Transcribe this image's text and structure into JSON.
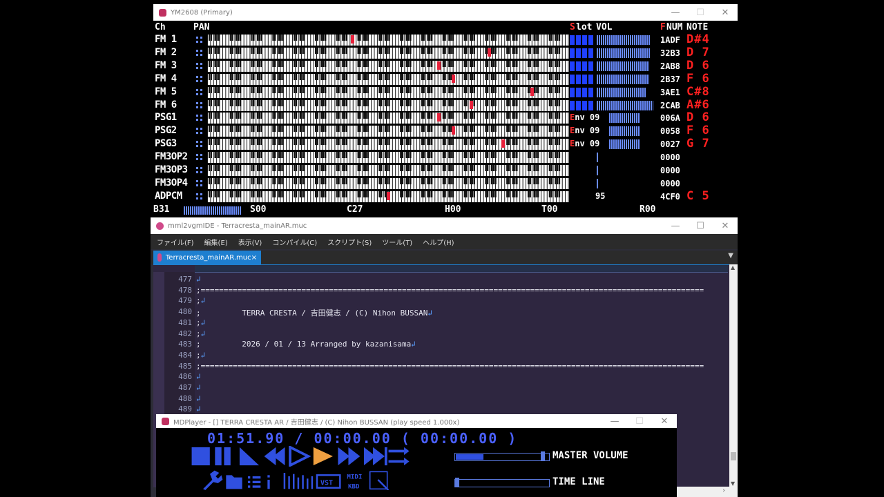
{
  "ym_window": {
    "title": "YM2608 (Primary)",
    "headers": {
      "ch": "Ch",
      "pan": "PAN",
      "slot_s": "S",
      "slot_rest": "lot",
      "vol": "VOL",
      "fnum_f": "F",
      "fnum_rest": "NUM",
      "note": "NOTE"
    },
    "channels": [
      {
        "label": "FM 1",
        "fnum": "1ADF",
        "note": "D#4"
      },
      {
        "label": "FM 2",
        "fnum": "32B3",
        "note": "D 7"
      },
      {
        "label": "FM 3",
        "fnum": "2AB8",
        "note": "D 6"
      },
      {
        "label": "FM 4",
        "fnum": "2B37",
        "note": "F 6"
      },
      {
        "label": "FM 5",
        "fnum": "3AE1",
        "note": "C#8"
      },
      {
        "label": "FM 6",
        "fnum": "2CAB",
        "note": "A#6"
      },
      {
        "label": "PSG1",
        "fnum": "006A",
        "note": "D 6",
        "env": "Env",
        "vol": "09"
      },
      {
        "label": "PSG2",
        "fnum": "0058",
        "note": "F 6",
        "env": "Env",
        "vol": "09"
      },
      {
        "label": "PSG3",
        "fnum": "0027",
        "note": "G 7",
        "env": "Env",
        "vol": "09"
      },
      {
        "label": "FM3OP2",
        "fnum": "0000",
        "note": ""
      },
      {
        "label": "FM3OP3",
        "fnum": "0000",
        "note": ""
      },
      {
        "label": "FM3OP4",
        "fnum": "0000",
        "note": ""
      },
      {
        "label": "ADPCM",
        "fnum": "4CF0",
        "note": "C 5",
        "extra": "95"
      }
    ],
    "bottom": {
      "b": "B31",
      "s": "S00",
      "c": "C27",
      "h": "H00",
      "t": "T00",
      "r": "R00"
    }
  },
  "ide_window": {
    "title": "mml2vgmIDE - Terracresta_mainAR.muc",
    "menu": [
      "ファイル(F)",
      "編集(E)",
      "表示(V)",
      "コンパイル(C)",
      "スクリプト(S)",
      "ツール(T)",
      "ヘルプ(H)"
    ],
    "tab_label": "Terracresta_mainAR.muc",
    "tab_close": "×",
    "lines": [
      {
        "num": "477",
        "text": ""
      },
      {
        "num": "478",
        "text": ";=============================================================================================================="
      },
      {
        "num": "479",
        "text": ";"
      },
      {
        "num": "480",
        "text": ";         TERRA CRESTA / 吉田健志 / (C) Nihon BUSSAN"
      },
      {
        "num": "481",
        "text": ";"
      },
      {
        "num": "482",
        "text": ";"
      },
      {
        "num": "483",
        "text": ";         2026 / 01 / 13 Arranged by kazanisama"
      },
      {
        "num": "484",
        "text": ";"
      },
      {
        "num": "485",
        "text": ";=============================================================================================================="
      },
      {
        "num": "486",
        "text": ""
      },
      {
        "num": "487",
        "text": ""
      },
      {
        "num": "488",
        "text": ""
      },
      {
        "num": "489",
        "text": ""
      }
    ],
    "return_mark": "↲"
  },
  "mdp_window": {
    "title": "MDPlayer - [] TERRA CRESTA AR / 吉田健志 / (C) Nihon BUSSAN (play speed 1.000x)",
    "time_display": "01:51.90 / 00:00.00 ( 00:00.00 )",
    "master_volume_label": "MASTER VOLUME",
    "master_volume_level": 0.3,
    "timeline_label": "TIME LINE",
    "timeline_level": 0.0,
    "midi_label": "MIDI",
    "kbd_label": "KBD",
    "vst_label": "VST"
  },
  "colors": {
    "accent": "#1e7fd0",
    "player_blue": "#3050e0",
    "note_red": "#ff2020"
  }
}
